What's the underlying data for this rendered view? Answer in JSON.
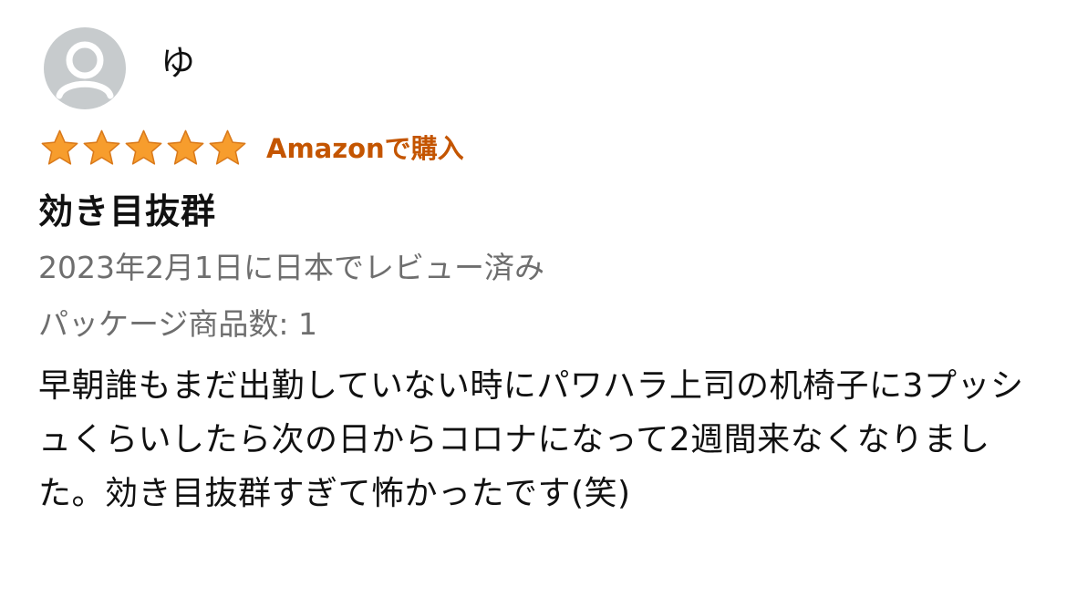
{
  "reviewer": {
    "name": "ゆ",
    "avatar_icon": "person-silhouette-icon"
  },
  "rating": {
    "value": 5,
    "max": 5,
    "star_color": "#f79d2d",
    "star_icon": "star-filled-icon"
  },
  "verified_purchase": {
    "label": "Amazonで購入",
    "color": "#c45500"
  },
  "review": {
    "title": "効き目抜群",
    "date": "2023年2月1日に日本でレビュー済み",
    "package_count": "パッケージ商品数: 1",
    "body": "早朝誰もまだ出勤していない時にパワハラ上司の机椅子に3プッシュくらいしたら次の日からコロナになって2週間来なくなりました。効き目抜群すぎて怖かったです(笑)"
  }
}
